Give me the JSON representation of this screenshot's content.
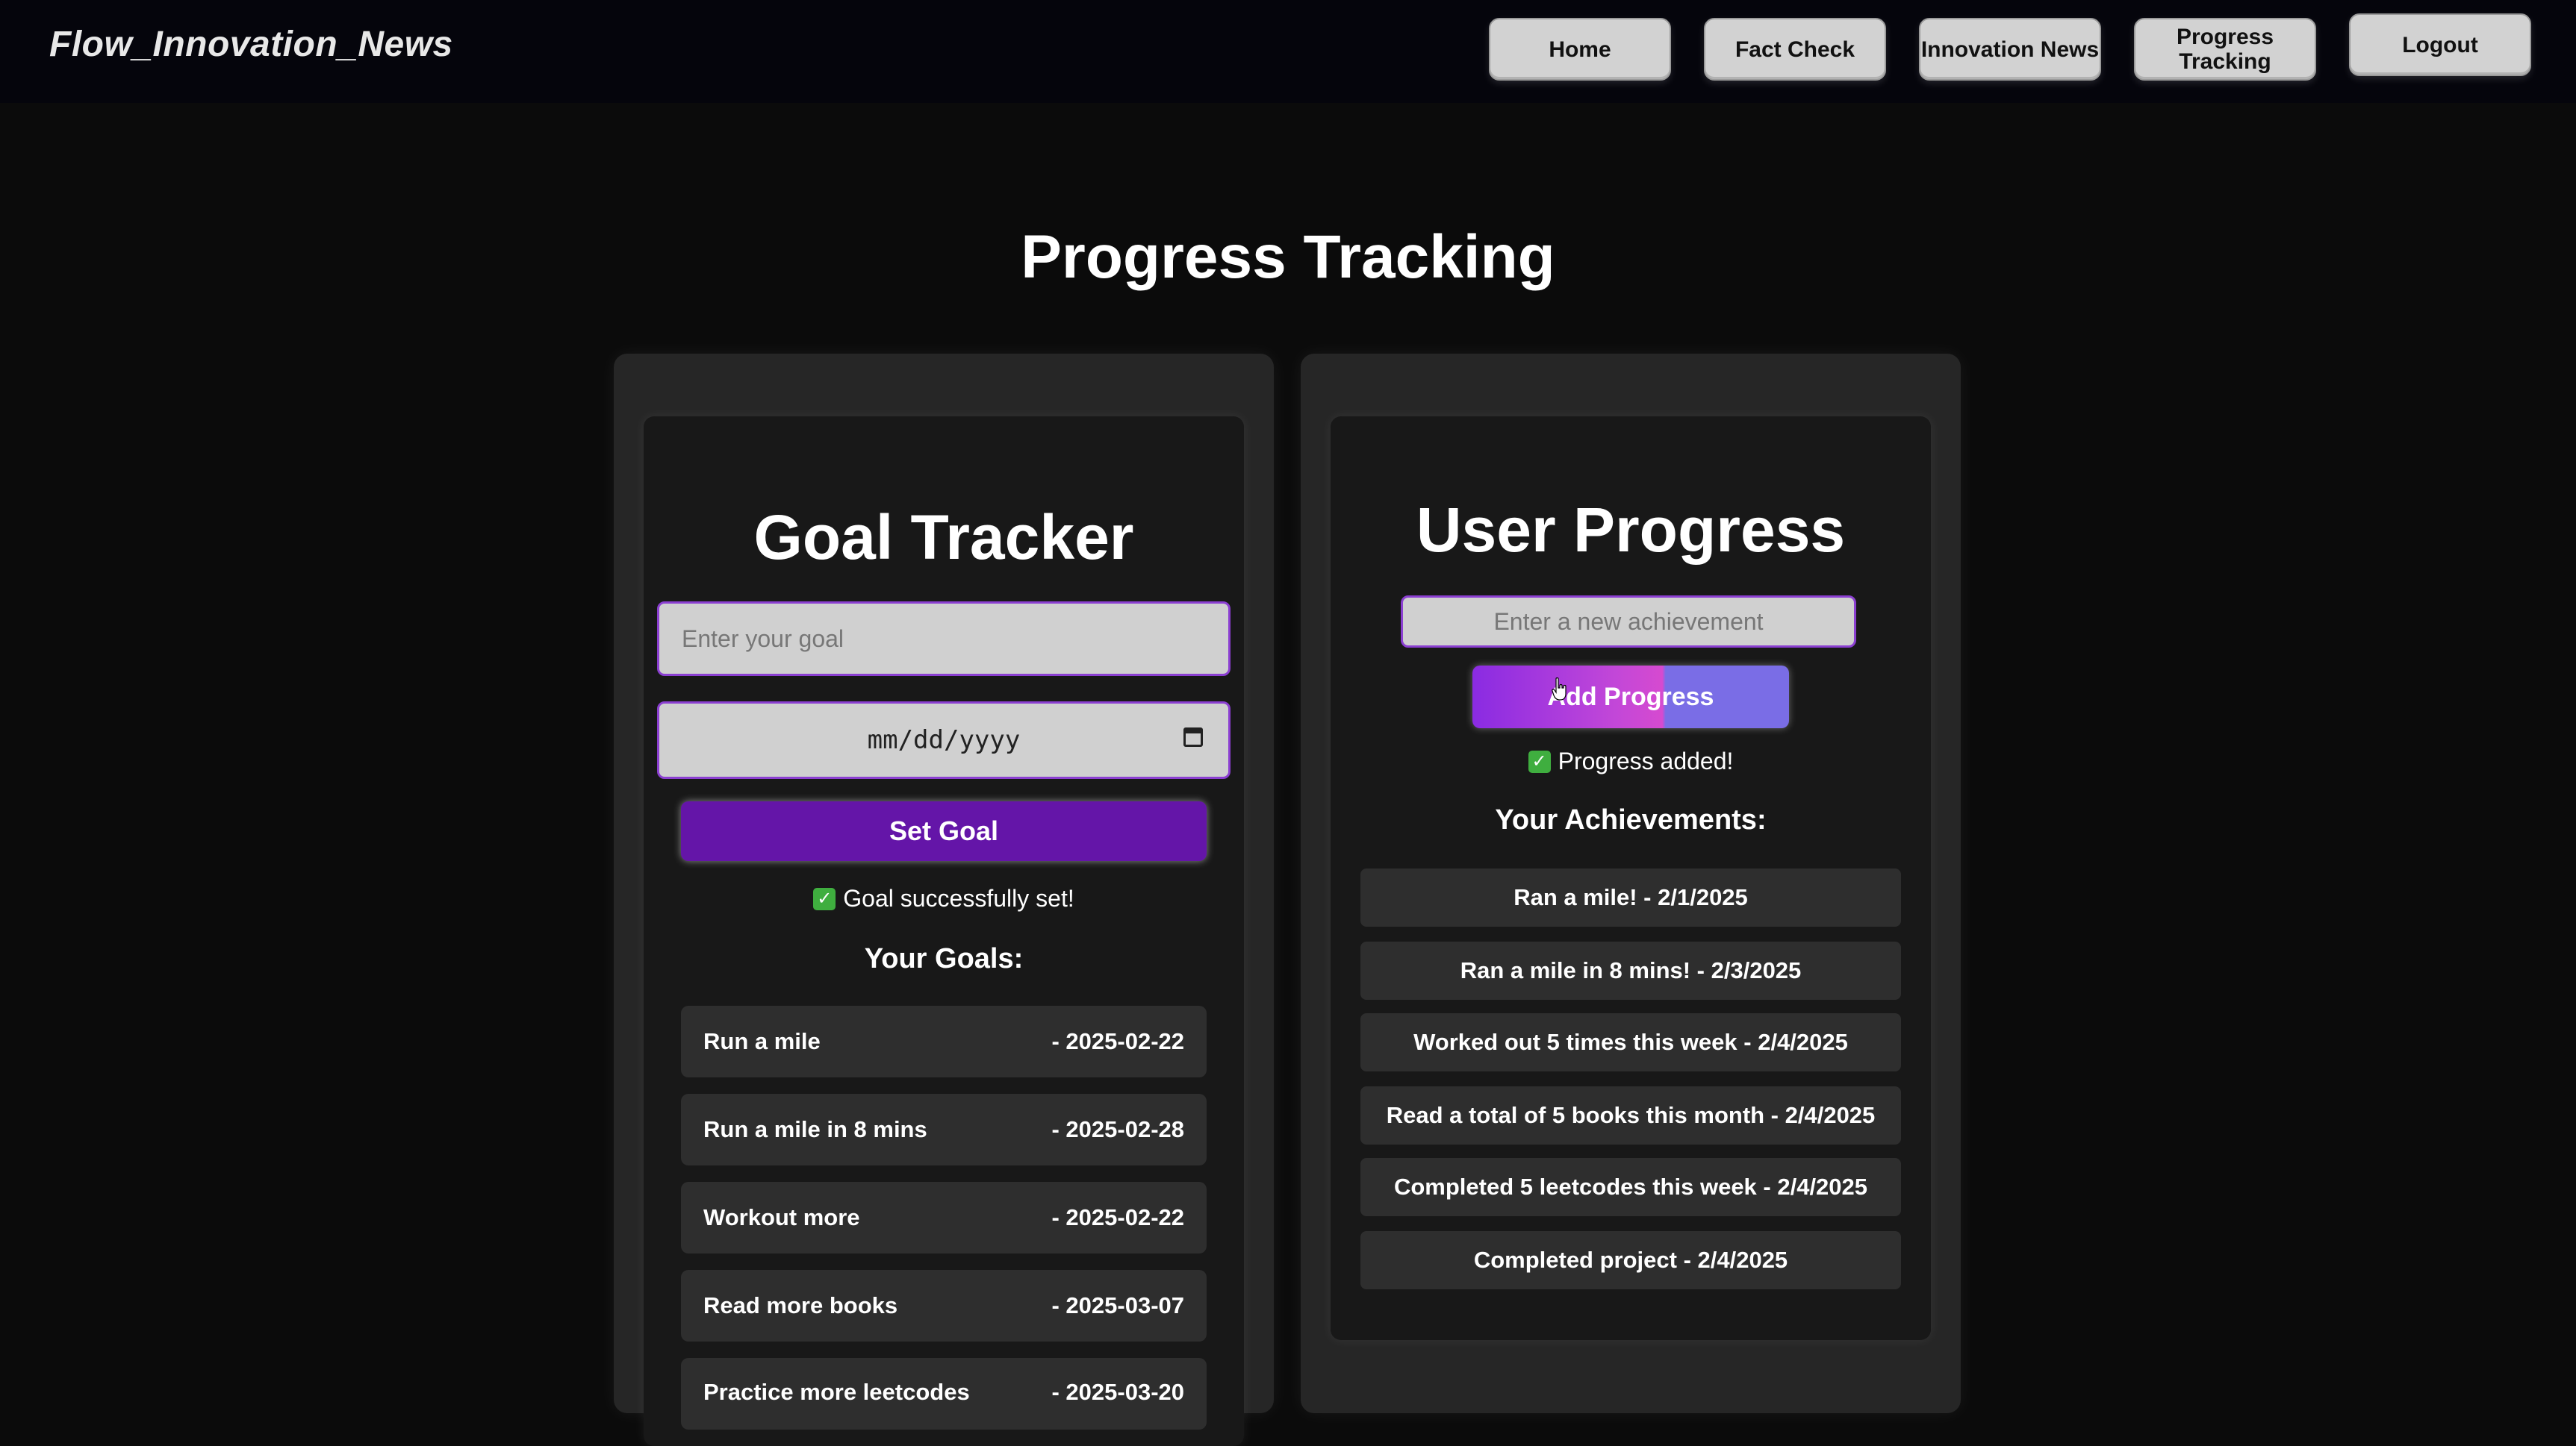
{
  "header": {
    "brand": "Flow_Innovation_News",
    "nav": [
      {
        "label": "Home"
      },
      {
        "label": "Fact Check"
      },
      {
        "label": "Innovation News"
      },
      {
        "label": "Progress Tracking"
      },
      {
        "label": "Logout"
      }
    ]
  },
  "page_title": "Progress Tracking",
  "goal_tracker": {
    "title": "Goal Tracker",
    "goal_input": {
      "placeholder": "Enter your goal",
      "value": ""
    },
    "date_input": {
      "placeholder": "mm/dd/yyyy"
    },
    "set_goal_label": "Set Goal",
    "status": "Goal successfully set!",
    "goals_heading": "Your Goals:",
    "goals": [
      {
        "name": "Run a mile",
        "date": "- 2025-02-22"
      },
      {
        "name": "Run a mile in 8 mins",
        "date": "- 2025-02-28"
      },
      {
        "name": "Workout more",
        "date": "- 2025-02-22"
      },
      {
        "name": "Read more books",
        "date": "- 2025-03-07"
      },
      {
        "name": "Practice more leetcodes",
        "date": "- 2025-03-20"
      }
    ]
  },
  "user_progress": {
    "title": "User Progress",
    "achievement_input": {
      "placeholder": "Enter a new achievement",
      "value": ""
    },
    "add_progress_label": "Add Progress",
    "status": "Progress added!",
    "achievements_heading": "Your Achievements:",
    "achievements": [
      "Ran a mile! - 2/1/2025",
      "Ran a mile in 8 mins! - 2/3/2025",
      "Worked out 5 times this week - 2/4/2025",
      "Read a total of 5 books this month - 2/4/2025",
      "Completed 5 leetcodes this week - 2/4/2025",
      "Completed project - 2/4/2025"
    ]
  },
  "colors": {
    "background": "#0b0b0b",
    "navbar": "#05050c",
    "accent_purple": "#6415a8",
    "input_border": "#8b3fd1",
    "success_green": "#3fae3f"
  },
  "icons": [
    "calendar-icon",
    "check-icon",
    "mouse-pointer-icon"
  ]
}
